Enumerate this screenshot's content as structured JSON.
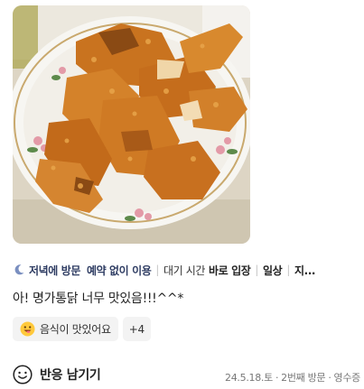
{
  "photo": {
    "alt_icon": "fried-chicken-photo"
  },
  "visit": {
    "time": "저녁에 방문",
    "reservation": "예약 없이 이용",
    "wait_label": "대기 시간",
    "wait_value": "바로 입장",
    "purpose": "일상",
    "overflow": "지..."
  },
  "review": {
    "text": "아! 명가통닭 너무 맛있음!!!^^*"
  },
  "keywords": {
    "first": "음식이 맛있어요",
    "more": "+4"
  },
  "footer": {
    "react_label": "반응 남기기",
    "date": "24.5.18.토",
    "visit_count": "2번째 방문",
    "receipt": "영수증"
  },
  "colors": {
    "accent": "#2f3d63",
    "moon": "#7a8fc0",
    "chip_bg": "#f3f3f3"
  }
}
